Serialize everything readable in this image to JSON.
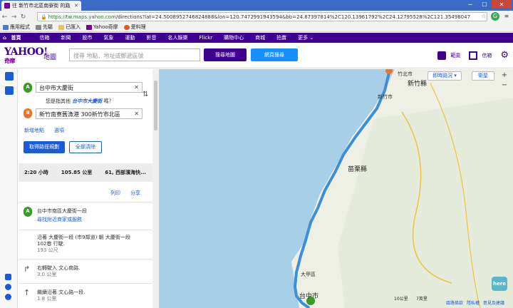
{
  "browser": {
    "tab_title": "往 新竹市北區南寮街 的路",
    "url_secure": "https://tw.maps.yahoo.com",
    "url_rest": "/directions?lat=24.5008952746824888&lon=120.7472991943594&bb=24.87397814%2C120.13961792%2C24.12795528%2C121.35498047",
    "window_controls": [
      "─",
      "☐",
      "✕"
    ]
  },
  "bookmarks": [
    "應用程式",
    "先驅",
    "已匯入",
    "Yahoo奇摩",
    "愛料理"
  ],
  "ynav": [
    "首頁",
    "信箱",
    "新聞",
    "股市",
    "氣象",
    "運動",
    "影音",
    "名人娛樂",
    "Flickr",
    "購物中心",
    "商城",
    "拍賣",
    "更多 ⌄"
  ],
  "header": {
    "logo_text": "YAHOO!",
    "logo_sub": "奇摩",
    "section": "地圖",
    "search_placeholder": "搜尋 地點、地址或郵遞區號",
    "btn_map": "搜尋地圖",
    "btn_web": "網頁搜尋",
    "user_label": "範雯",
    "mail_label": "信箱"
  },
  "directions": {
    "from": "台中市大慶街",
    "to": "新竹南寮舊漁港 300新竹市北區",
    "suggest_prefix": "您是指其他",
    "suggest_link": "台中市大慶街",
    "suggest_suffix": " 嗎？",
    "add_stop": "新增地點",
    "options": "選項",
    "btn_clear": "取得路徑規劃",
    "btn_full": "全部清除",
    "summary_time": "2:20 小時",
    "summary_dist": "105.85 公里",
    "summary_road": "61, 西部濱海快...",
    "print": "列印",
    "share": "分享",
    "start_addr": "台中市南區大慶街一段",
    "start_link": "尋找附近商家或服務",
    "steps": [
      {
        "text1": "沿著 大慶街一段 (市9鄰道) 朝 大慶街一段",
        "text2": "102巷 行駛.",
        "dist": "193 公尺"
      },
      {
        "text1": "右轉駛入 文心南路.",
        "text2": "",
        "dist": "3.0 公里"
      },
      {
        "text1": "繼續沿著 文心路一段.",
        "text2": "",
        "dist": "1.8 公里"
      }
    ]
  },
  "map": {
    "btn_traffic": "即時路況",
    "btn_satellite": "衛星",
    "labels": [
      "新竹縣",
      "苗栗縣",
      "台中市",
      "大甲區",
      "新竹市",
      "竹北市"
    ],
    "scale_km": "10公里",
    "scale_mi": "7英里",
    "footer_links": [
      "區路條款",
      "隱私權",
      "意見及建議"
    ],
    "here_logo": "here",
    "zoom_in": "+",
    "zoom_out": "−"
  },
  "colors": {
    "purple": "#400090",
    "route": "#3d8fd6",
    "sea": "#a8cfe8",
    "land": "#eef0e6"
  }
}
